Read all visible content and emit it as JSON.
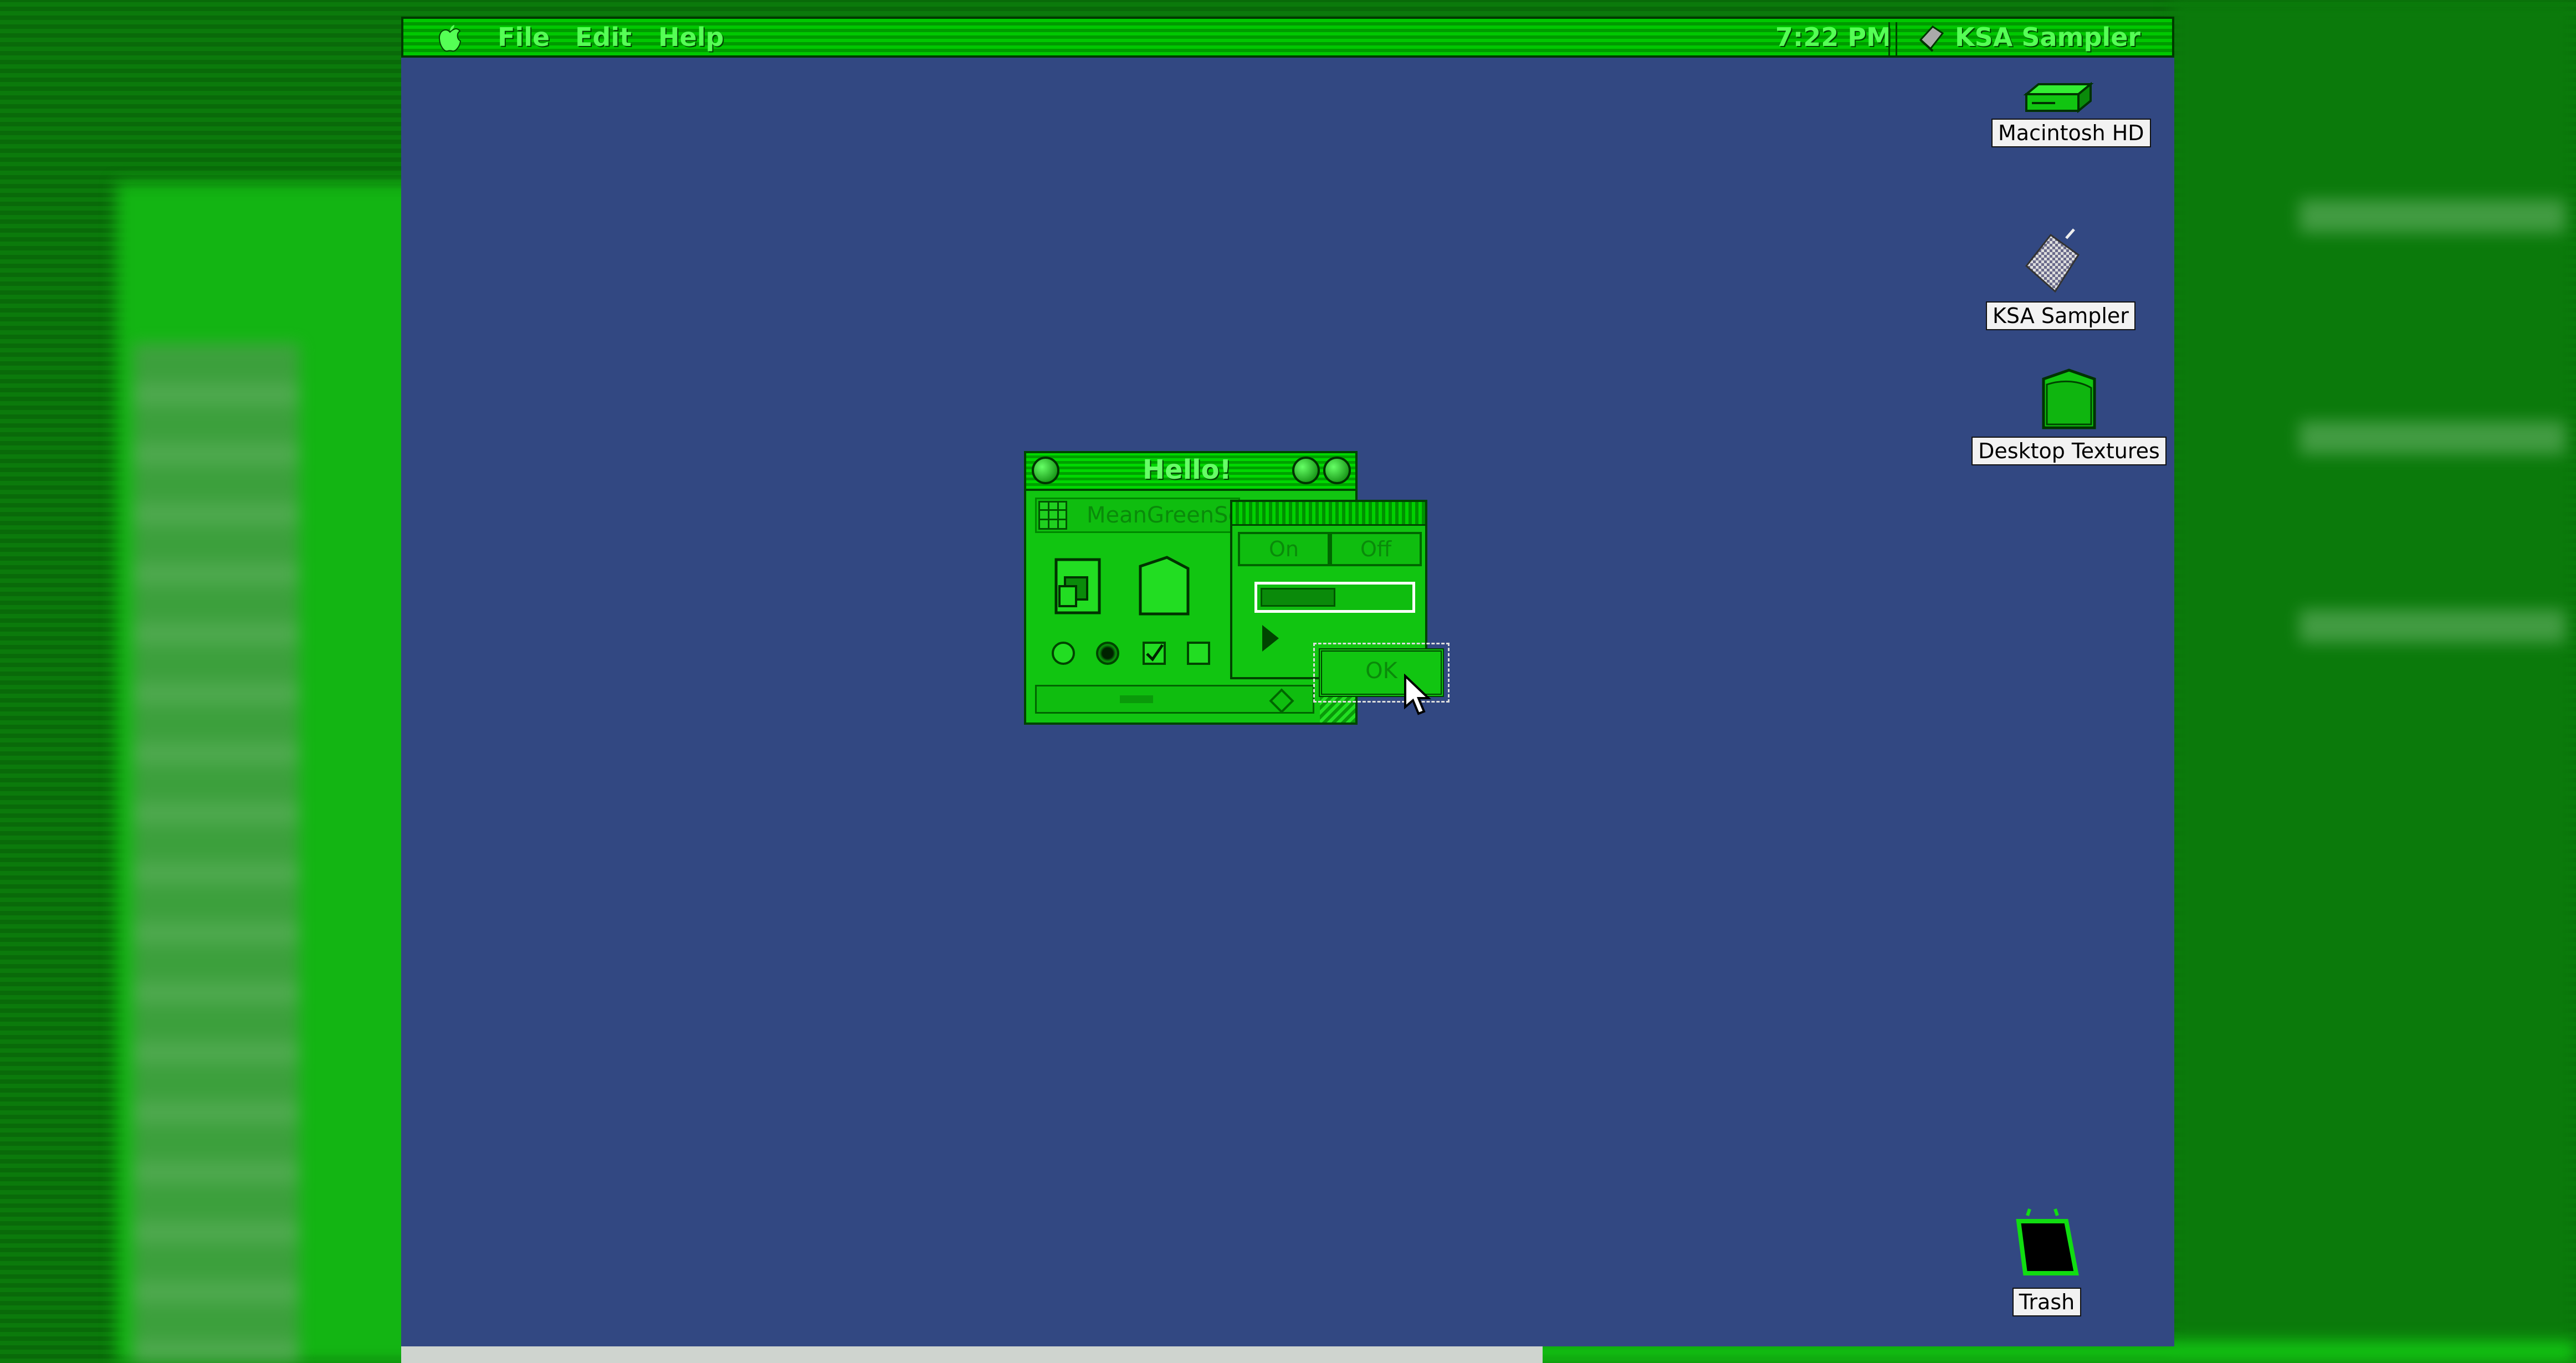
{
  "menubar": {
    "menus": [
      "File",
      "Edit",
      "Help"
    ],
    "clock": "7:22 PM",
    "app_name": "KSA Sampler"
  },
  "desktop": {
    "icons": [
      {
        "label": "Macintosh HD",
        "icon": "hard-drive-icon"
      },
      {
        "label": "KSA Sampler",
        "icon": "app-icon"
      },
      {
        "label": "Desktop Textures",
        "icon": "folder-icon"
      },
      {
        "label": "Trash",
        "icon": "trash-icon"
      }
    ]
  },
  "window": {
    "title": "Hello!",
    "tab_label": "MeanGreenSc"
  },
  "dialog": {
    "segment_on": "On",
    "segment_off": "Off",
    "progress": 0.5,
    "ok_label": "OK"
  },
  "colors": {
    "desktop": "#324882",
    "theme_green": "#11c511",
    "dark_green": "#004400"
  }
}
